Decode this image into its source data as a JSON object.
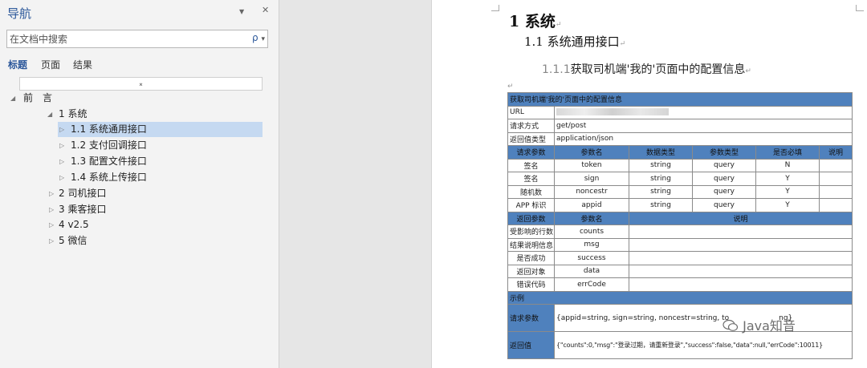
{
  "nav": {
    "title": "导航",
    "dropdown_glyph": "▼",
    "close_glyph": "✕",
    "search": {
      "placeholder": "在文档中搜索",
      "value": "",
      "search_glyph": "ρ",
      "menu_glyph": "▾"
    },
    "tabs": [
      "标题",
      "页面",
      "结果"
    ],
    "collapse_glyph": "⌅",
    "tree": [
      {
        "label": "前　言",
        "arrow": "◢"
      },
      {
        "label": "1 系统",
        "arrow": "◢"
      },
      {
        "label": "1.1 系统通用接口",
        "arrow": "▷"
      },
      {
        "label": "1.2 支付回调接口",
        "arrow": "▷"
      },
      {
        "label": "1.3 配置文件接口",
        "arrow": "▷"
      },
      {
        "label": "1.4 系统上传接口",
        "arrow": "▷"
      },
      {
        "label": "2 司机接口",
        "arrow": "▷"
      },
      {
        "label": "3 乘客接口",
        "arrow": "▷"
      },
      {
        "label": "4 v2.5",
        "arrow": "▷"
      },
      {
        "label": "5 微信",
        "arrow": "▷"
      }
    ]
  },
  "doc": {
    "para_mark": "↵",
    "h1": "1  系统",
    "h2": "1.1 系统通用接口",
    "h3_num": "1.1.1",
    "h3_text": "获取司机端'我的'页面中的配置信息",
    "table": {
      "title": "获取司机端'我的'页面中的配置信息",
      "url_label": "URL",
      "method_label": "请求方式",
      "method_value": "get/post",
      "return_type_label": "返回值类型",
      "return_type_value": "application/json",
      "req_headers": [
        "请求参数",
        "参数名",
        "数据类型",
        "参数类型",
        "是否必填",
        "说明"
      ],
      "req_rows": [
        [
          "签名",
          "token",
          "string",
          "query",
          "N",
          ""
        ],
        [
          "签名",
          "sign",
          "string",
          "query",
          "Y",
          ""
        ],
        [
          "随机数",
          "noncestr",
          "string",
          "query",
          "Y",
          ""
        ],
        [
          "APP 标识",
          "appid",
          "string",
          "query",
          "Y",
          ""
        ]
      ],
      "resp_headers": [
        "返回参数",
        "参数名",
        "说明"
      ],
      "resp_rows": [
        [
          "受影响的行数",
          "counts",
          ""
        ],
        [
          "结果说明信息",
          "msg",
          ""
        ],
        [
          "是否成功",
          "success",
          ""
        ],
        [
          "返回对象",
          "data",
          ""
        ],
        [
          "错误代码",
          "errCode",
          ""
        ]
      ],
      "example_label": "示例",
      "example_req_label": "请求参数",
      "example_req_value": "{appid=string, sign=string, noncestr=string, to",
      "example_req_tail": "ng}",
      "example_resp_label": "返回值",
      "example_resp_value": "{\"counts\":0,\"msg\":\"登录过期，请重新登录\",\"success\":false,\"data\":null,\"errCode\":10011}"
    }
  },
  "watermark": "Java知音"
}
